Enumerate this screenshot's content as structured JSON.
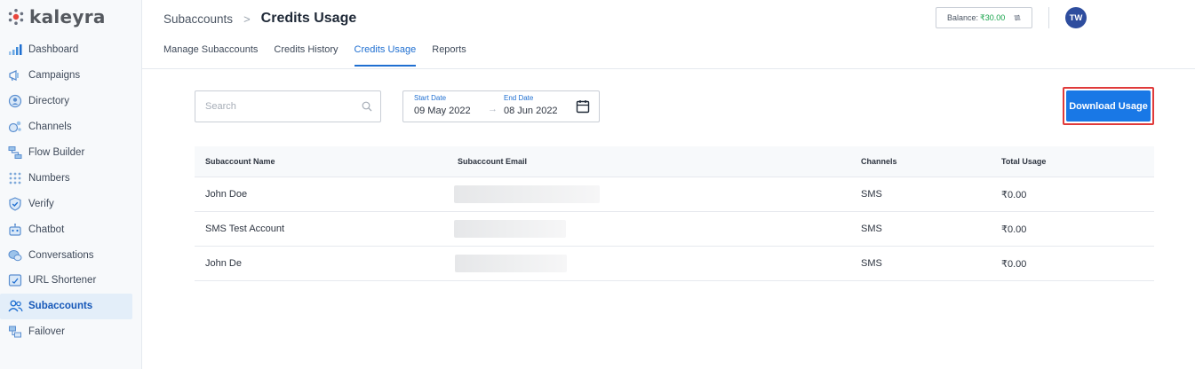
{
  "brand": {
    "name": "kaleyra"
  },
  "sidebar": {
    "items": [
      {
        "label": "Dashboard",
        "icon": "bar-chart-icon"
      },
      {
        "label": "Campaigns",
        "icon": "megaphone-icon"
      },
      {
        "label": "Directory",
        "icon": "contact-icon"
      },
      {
        "label": "Channels",
        "icon": "channels-icon"
      },
      {
        "label": "Flow Builder",
        "icon": "flow-icon"
      },
      {
        "label": "Numbers",
        "icon": "dialpad-icon"
      },
      {
        "label": "Verify",
        "icon": "shield-check-icon"
      },
      {
        "label": "Chatbot",
        "icon": "robot-icon"
      },
      {
        "label": "Conversations",
        "icon": "chat-bubbles-icon"
      },
      {
        "label": "URL Shortener",
        "icon": "link-icon"
      },
      {
        "label": "Subaccounts",
        "icon": "users-icon",
        "active": true
      },
      {
        "label": "Failover",
        "icon": "failover-icon"
      }
    ]
  },
  "header": {
    "breadcrumb_parent": "Subaccounts",
    "breadcrumb_separator": ">",
    "title": "Credits Usage",
    "balance_label": "Balance:",
    "balance_value": "₹30.00",
    "avatar_initials": "TW"
  },
  "tabs": [
    {
      "label": "Manage Subaccounts"
    },
    {
      "label": "Credits History"
    },
    {
      "label": "Credits Usage",
      "active": true
    },
    {
      "label": "Reports"
    }
  ],
  "filters": {
    "search_placeholder": "Search",
    "start_label": "Start Date",
    "start_value": "09 May 2022",
    "end_label": "End Date",
    "end_value": "08 Jun 2022",
    "arrow": "→"
  },
  "download_button": {
    "label": "Download Usage"
  },
  "table": {
    "columns": [
      "Subaccount Name",
      "Subaccount Email",
      "Channels",
      "Total Usage"
    ],
    "rows": [
      {
        "name": "John Doe",
        "channels": "SMS",
        "total_usage": "₹0.00"
      },
      {
        "name": "SMS Test Account",
        "channels": "SMS",
        "total_usage": "₹0.00"
      },
      {
        "name": "John De",
        "channels": "SMS",
        "total_usage": "₹0.00"
      }
    ]
  },
  "colors": {
    "accent": "#1f6fd1",
    "button": "#1978e6",
    "highlight_border": "#e03a3a",
    "balance_green": "#16a34a",
    "avatar": "#2e4d9e",
    "sidebar_active_bg": "#e3eef9"
  }
}
